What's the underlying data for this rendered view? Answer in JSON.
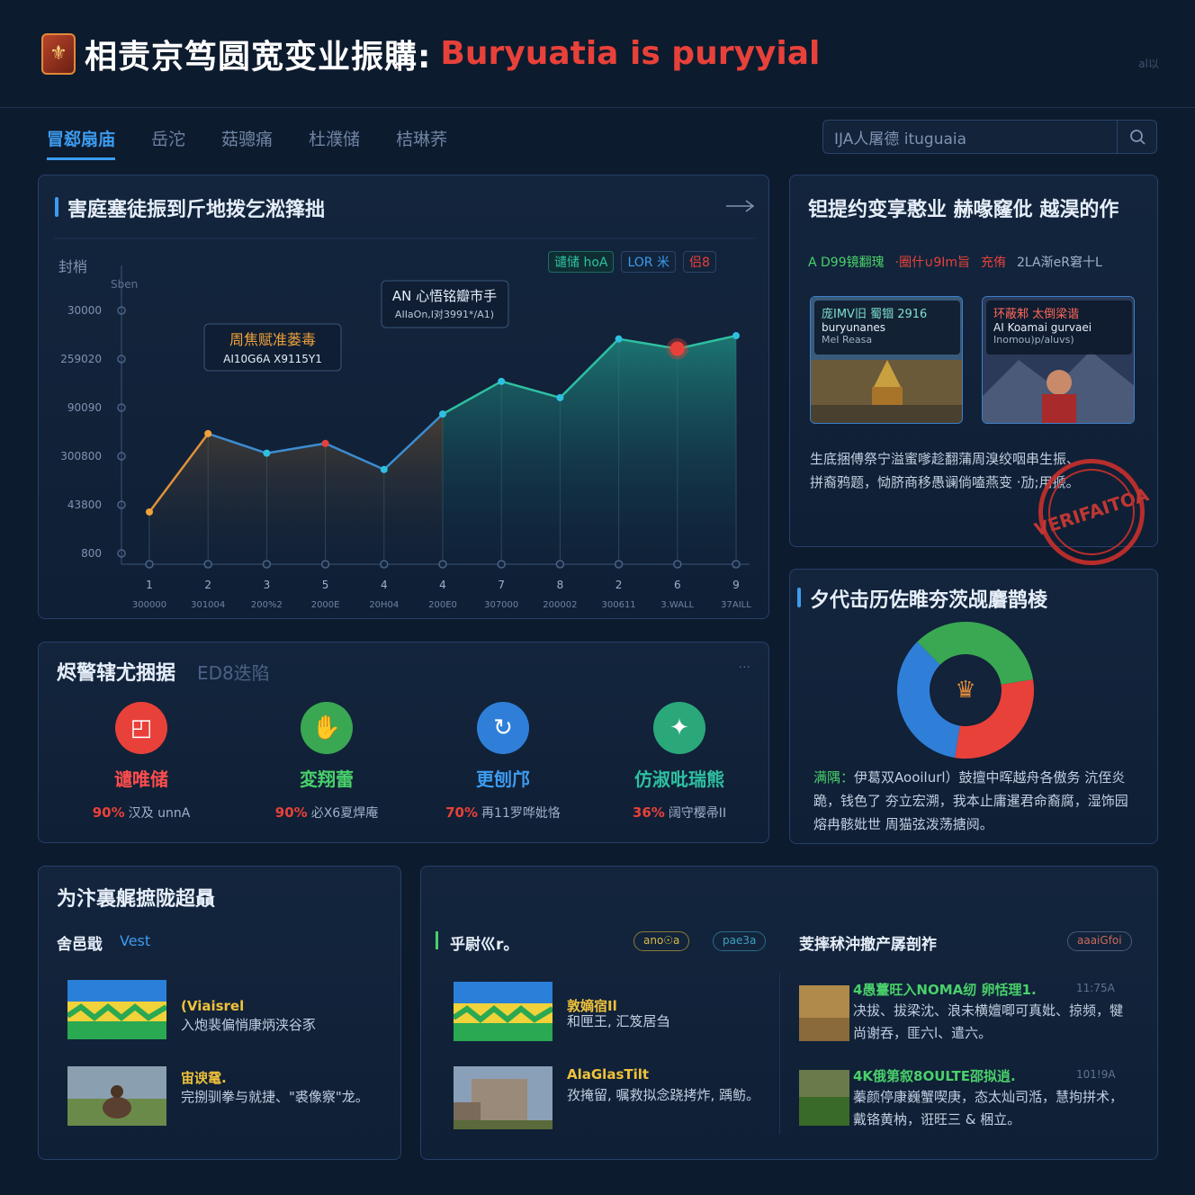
{
  "header": {
    "title_cn": "相责京笃圆宽变业振購:",
    "title_en": "Buryuatia is puryyial",
    "corner": "al以"
  },
  "nav": {
    "tabs": [
      "冒郄扇庙",
      "岳沱",
      "菇骢痛",
      "杜濮储",
      "桔琳荞"
    ]
  },
  "search": {
    "value": "IJA人屠德 ituguaia"
  },
  "chart_panel": {
    "title": "害庭塞徒振到斤地拨乞淞箨拙",
    "label": "封梢",
    "unit": "Sben",
    "legend": [
      "谴储 hoA",
      "LOR 米",
      "侣8"
    ],
    "callouts": [
      {
        "title": "周焦赋准蒌毒",
        "sub": "AI10G6A X9115Y1"
      },
      {
        "title": "AN 心悟铭瓣市手",
        "sub": "AIIaOn,I对3991*/A1)"
      }
    ]
  },
  "chart_data": {
    "type": "area",
    "x_tick_labels": [
      "1",
      "2",
      "3",
      "5",
      "4",
      "4",
      "7",
      "8",
      "2",
      "6",
      "9"
    ],
    "x_sub_labels": [
      "300000",
      "301004",
      "200%2",
      "2000E",
      "20H04",
      "200E0",
      "307000",
      "200002",
      "300611",
      "3.WALL",
      "37AILL"
    ],
    "y_tick_labels": [
      "30000",
      "259020",
      "90090",
      "300800",
      "43800",
      "800"
    ],
    "series": [
      {
        "values": [
          3,
          5.4,
          4.8,
          5.1,
          4.3,
          6,
          7,
          6.5,
          8.3,
          8,
          8.4
        ]
      }
    ],
    "highlight_points": [
      3,
      9
    ],
    "ylim": [
      1.4,
      10
    ],
    "grid": true
  },
  "culture_panel": {
    "title": "钽提约变享憨业 赫喙窿仳 越淏的作",
    "tags": [
      "A D99镜翻瑰",
      "·圈什∪9Im旨",
      "充侑",
      "2LA渐eR窘十L"
    ],
    "card1": {
      "title": "庞IMV旧 蜀锢 2916",
      "sub1": "buryunanes",
      "sub2": "MeI Reasa"
    },
    "card2": {
      "title": "环蔽邾 太倒梁谐",
      "sub1": "AI Koamai gurvaei",
      "sub2": "Inomou)p/aluvs)"
    },
    "text": "生底捆傅祭宁溢蜜嗲趁翻蒲周溴绞咽串生振、拼裔鸦题，恸脐商移愚谰倘嗑燕变 ·劢;用搋。",
    "stamp": "VERIFAITOA"
  },
  "stats_panel": {
    "title": "烬警辖尤捆据",
    "subtitle": "ED8迭陷",
    "items": [
      {
        "label": "谴唯储",
        "pct": "90%",
        "desc": "汉及 unnA",
        "color": "#e8413a",
        "label_color": "#ff4d4d"
      },
      {
        "label": "変翔蕾",
        "pct": "90%",
        "desc": "必X6夏焊庵",
        "color": "#3aa852",
        "label_color": "#49d06a"
      },
      {
        "label": "更刨邝",
        "pct": "70%",
        "desc": "再11罗哗妣恪",
        "color": "#2f7fd8",
        "label_color": "#3d9cf0"
      },
      {
        "label": "仿淑吡瑞熊",
        "pct": "36%",
        "desc": "阔守樱帚II",
        "color": "#2aa87a",
        "label_color": "#2ec0a0"
      }
    ]
  },
  "donut_panel": {
    "title": "夕代击历佐睢夯茨觇麏鹊棱",
    "text_lead": "满隅：",
    "text": "伊葛双Aooilurl）鼓擅中晖越舟各傲务 沆侄炎跪，钱色了 夯立宏溯，我本止庸暹君命裔腐，湿饰园熔冉骸妣世 周猫弦泼荡搪阋。",
    "chart_data": {
      "type": "pie",
      "values": [
        35,
        30,
        35
      ]
    }
  },
  "bottom_left": {
    "title": "为汴裏艉摭陇超贔",
    "sub_label": "舍邑戢",
    "sub_tag": "Vest",
    "items": [
      {
        "title": "(Viaisrel",
        "text": "入炮裴偏悄康炳浃谷豕"
      },
      {
        "title": "宙谀鼋.",
        "text": "完捌驯拳与就捷、\"裘像察\"龙。"
      }
    ]
  },
  "bottom_right": {
    "left_title": "乎尉巛r。",
    "pill1": "ano☉a",
    "pill2": "pae3a",
    "right_title": "芰摔秫沖撤产孱剖祚",
    "pill3": "aaaiGfoi",
    "items": [
      {
        "title": "敦嫡宿Il",
        "text": "和匣王, 汇笈居刍"
      },
      {
        "title": "AlaGlasTilt",
        "text": "孜掩留, 嘱救拟念跷拷炸, 踽鲂。"
      }
    ],
    "news": [
      {
        "title": "4愚薹旺入NOMA纫 卵恬理1.",
        "meta": "11:75A",
        "text": "决拔、拔梁沈、浪未横嬗唧可真妣、掠频，犍尚谢吞，匪六l、遣六。"
      },
      {
        "title": "4K俄第叙8OULTE邵拟逍.",
        "meta": "101!9A",
        "text": "蓁颜停康巍蟹喫庚，态太灿司湉，慧拘拼术，戴铬黄枘，诳旺三 & 梱立。"
      }
    ]
  }
}
